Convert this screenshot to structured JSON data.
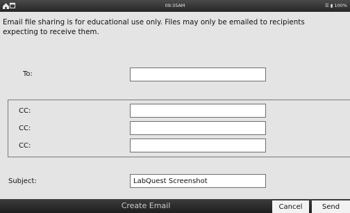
{
  "status_bar": {
    "time": "09:35AM",
    "battery": "100%",
    "icons": [
      "home-icon",
      "window-icon",
      "wifi-icon",
      "battery-icon"
    ]
  },
  "notice": {
    "line1": "Email file sharing is for educational use only. Files may only be emailed to recipients",
    "line2": "expecting to receive them."
  },
  "form": {
    "to_label": "To:",
    "to_value": "",
    "cc_labels": [
      "CC:",
      "CC:",
      "CC:"
    ],
    "cc_values": [
      "",
      "",
      ""
    ],
    "subject_label": "Subject:",
    "subject_value": "LabQuest Screenshot"
  },
  "bottom_bar": {
    "title": "Create Email",
    "cancel_label": "Cancel",
    "send_label": "Send"
  }
}
